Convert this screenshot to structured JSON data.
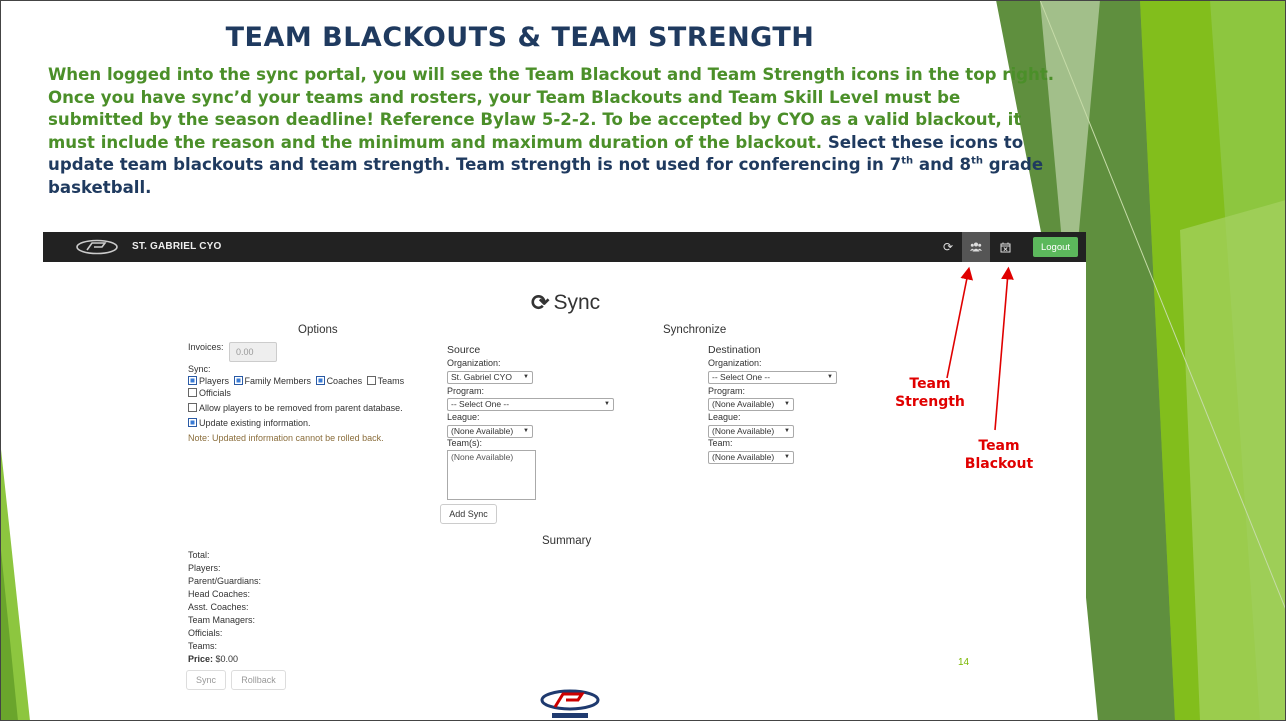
{
  "slide": {
    "title": "TEAM BLACKOUTS & TEAM STRENGTH",
    "para_green_1": "When logged into the sync portal, you will see the Team Blackout and Team Strength icons in the top right. Once you have sync’d your teams and rosters, your Team Blackouts and Team Skill Level must be submitted by the season deadline! Reference Bylaw 5-2-2. To be accepted by CYO as a valid blackout, it must include the reason and the minimum and maximum duration of the blackout.",
    "para_dark_1": "Select these icons to update team blackouts and team strength. Team strength is not used for conferencing in 7",
    "sup_1": "th",
    "para_dark_2": " and 8",
    "sup_2": "th",
    "para_dark_3": " grade basketball.",
    "page_number": "14",
    "annotations": {
      "strength": "Team Strength",
      "blackout": "Team Blackout"
    }
  },
  "app": {
    "brand": "ST. GABRIEL CYO",
    "nav_icons": [
      "refresh-icon",
      "team-icon",
      "calendar-icon"
    ],
    "logout_label": "Logout",
    "accent_color": "#5cb85c",
    "heading": "Sync",
    "options": {
      "title": "Options",
      "invoices_label": "Invoices:",
      "invoices_value": "0.00",
      "sync_label": "Sync:",
      "players": "Players",
      "family_members": "Family Members",
      "coaches": "Coaches",
      "teams": "Teams",
      "officials": "Officials",
      "allow_remove": "Allow players to be removed from parent database.",
      "update_existing": "Update existing information.",
      "note": "Note: Updated information cannot be rolled back."
    },
    "synchronize": {
      "title": "Synchronize",
      "source": {
        "title": "Source",
        "organization_label": "Organization:",
        "organization_value": "St. Gabriel CYO",
        "program_label": "Program:",
        "program_value": "-- Select One --",
        "league_label": "League:",
        "league_value": "(None Available)",
        "teams_label": "Team(s):",
        "teams_value": "(None Available)"
      },
      "destination": {
        "title": "Destination",
        "organization_label": "Organization:",
        "organization_value": "-- Select One --",
        "program_label": "Program:",
        "program_value": "(None Available)",
        "league_label": "League:",
        "league_value": "(None Available)",
        "team_label": "Team:",
        "team_value": "(None Available)"
      },
      "add_sync_label": "Add Sync"
    },
    "summary": {
      "title": "Summary",
      "total": "Total:",
      "players": "Players:",
      "parents": "Parent/Guardians:",
      "head_coaches": "Head Coaches:",
      "asst_coaches": "Asst. Coaches:",
      "team_managers": "Team Managers:",
      "officials": "Officials:",
      "teams": "Teams:",
      "price_label": "Price:",
      "price_value": "$0.00",
      "sync_label": "Sync",
      "rollback_label": "Rollback"
    }
  }
}
